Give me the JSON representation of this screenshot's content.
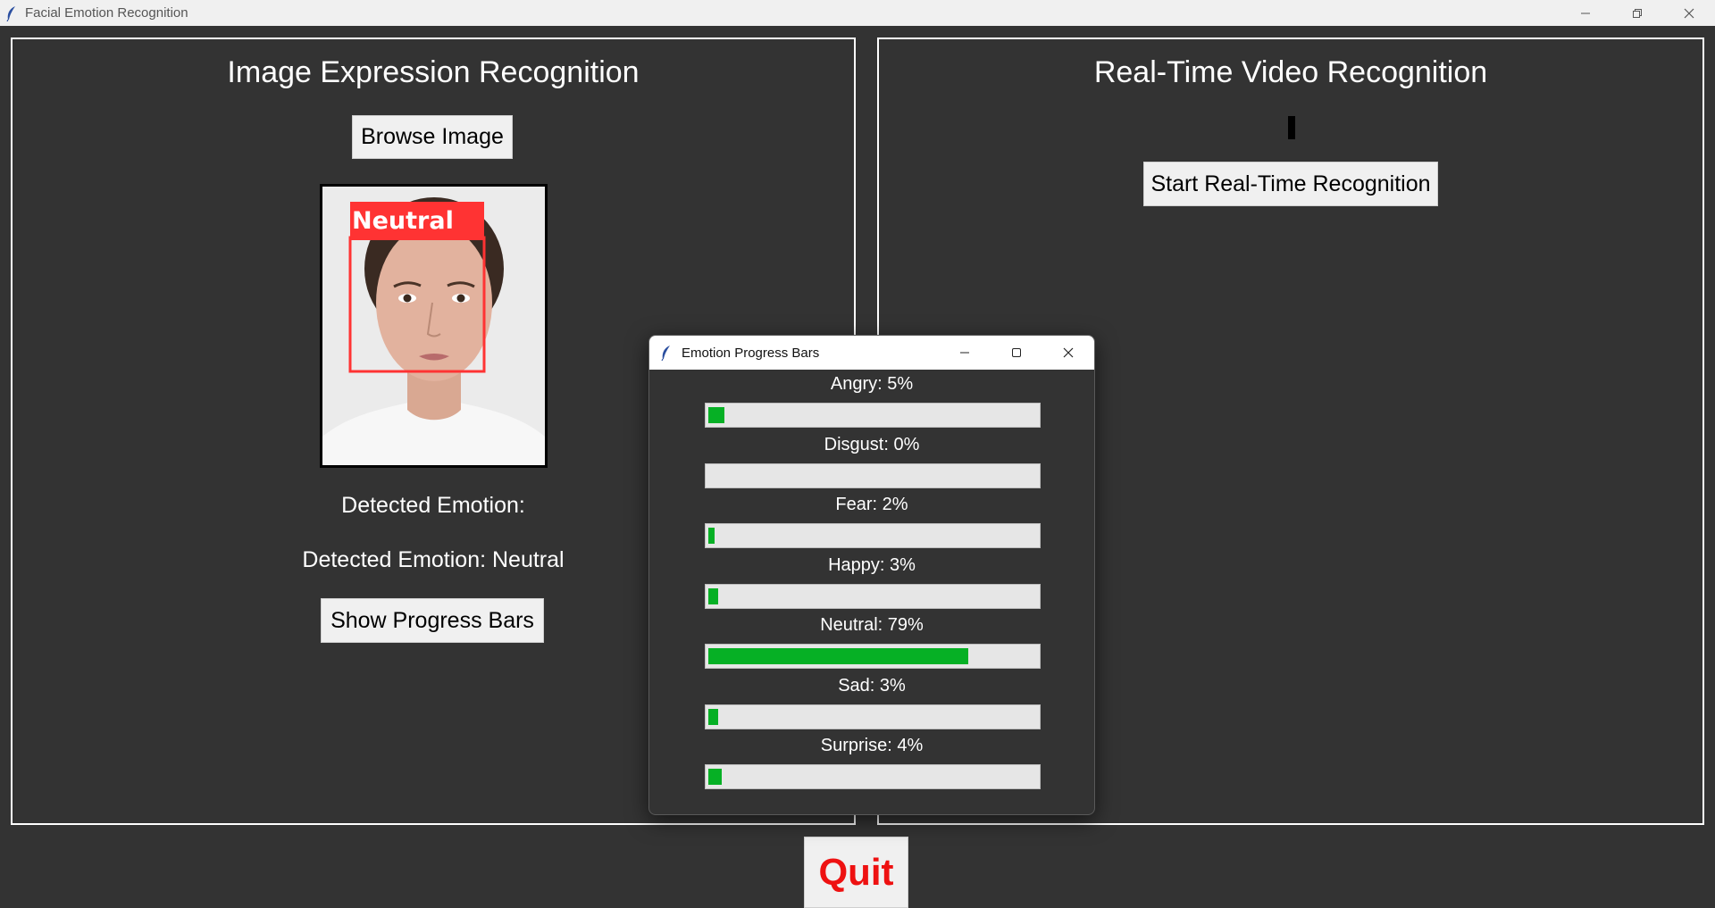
{
  "window": {
    "title": "Facial Emotion Recognition",
    "icon": "feather-icon",
    "controls": [
      "minimize-icon",
      "restore-icon",
      "close-icon"
    ]
  },
  "left_panel": {
    "title": "Image Expression Recognition",
    "browse_label": "Browse Image",
    "image_overlay_label": "Neutral",
    "detected_label": "Detected Emotion:",
    "detected_value": "Detected Emotion: Neutral",
    "progress_button_label": "Show Progress Bars"
  },
  "right_panel": {
    "title": "Real-Time Video Recognition",
    "start_label": "Start Real-Time Recognition"
  },
  "quit_label": "Quit",
  "popup": {
    "title": "Emotion Progress Bars",
    "icon": "feather-icon",
    "bars": [
      {
        "label": "Angry: 5%",
        "value": 5
      },
      {
        "label": "Disgust: 0%",
        "value": 0
      },
      {
        "label": "Fear: 2%",
        "value": 2
      },
      {
        "label": "Happy: 3%",
        "value": 3
      },
      {
        "label": "Neutral: 79%",
        "value": 79
      },
      {
        "label": "Sad: 3%",
        "value": 3
      },
      {
        "label": "Surprise: 4%",
        "value": 4
      }
    ]
  },
  "colors": {
    "background": "#333333",
    "progress_fill": "#06b025",
    "quit_text": "#ee1111",
    "face_box": "#ff3333"
  }
}
